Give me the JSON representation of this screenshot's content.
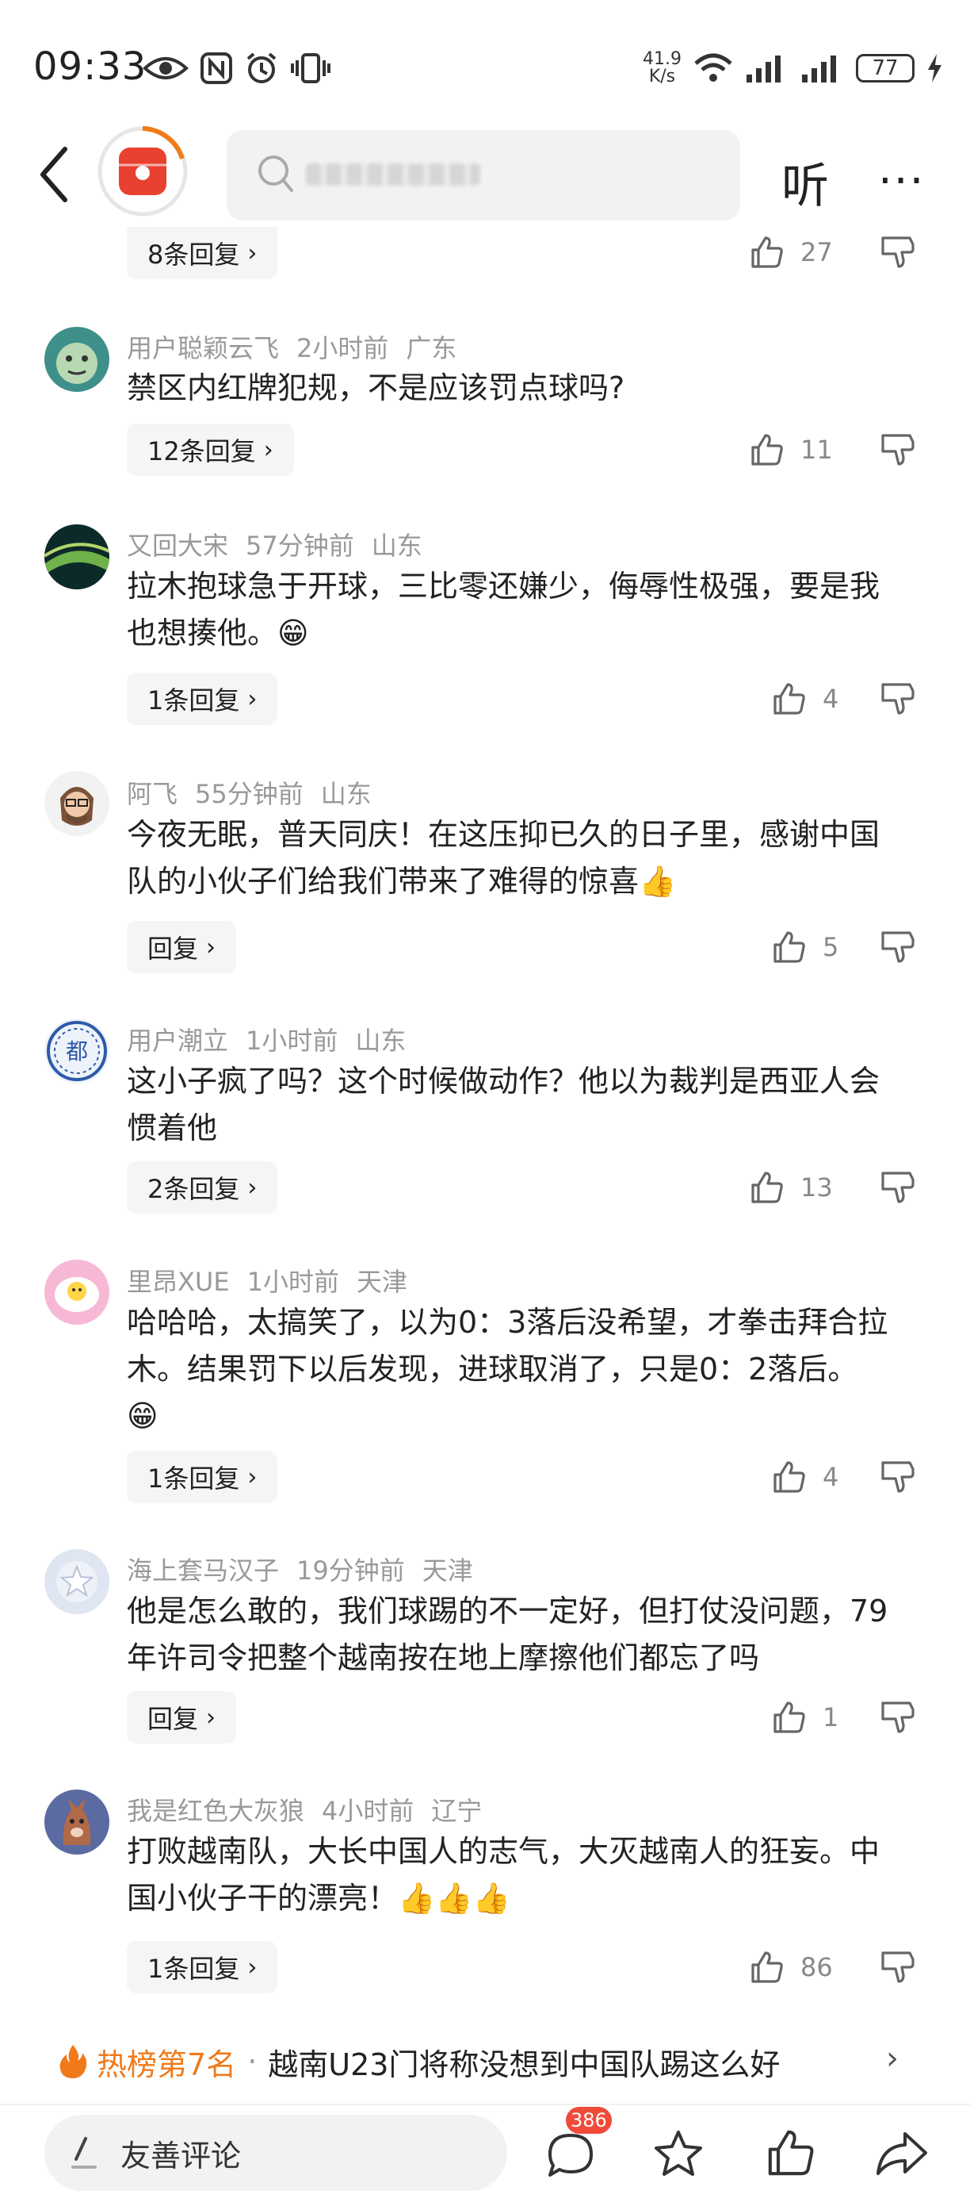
{
  "status_bar": {
    "time": "09:33",
    "net_speed_value": "41.9",
    "net_speed_unit": "K/s",
    "battery": "77"
  },
  "header": {
    "search_placeholder": "",
    "listen_label": "听",
    "more_label": "···"
  },
  "top_partial": {
    "reply_label": "8条回复",
    "likes": "27"
  },
  "comments": [
    {
      "user": "用户聪颖云飞",
      "time": "2小时前",
      "location": "广东",
      "lines": [
        "禁区内红牌犯规，不是应该罚点球吗?"
      ],
      "reply_label": "12条回复",
      "likes": "11"
    },
    {
      "user": "又回大宋",
      "time": "57分钟前",
      "location": "山东",
      "lines": [
        "拉木抱球急于开球，三比零还嫌少，侮辱性极强，要是我",
        "也想揍他。😁"
      ],
      "reply_label": "1条回复",
      "likes": "4"
    },
    {
      "user": "阿飞",
      "time": "55分钟前",
      "location": "山东",
      "lines": [
        "今夜无眠，普天同庆！在这压抑已久的日子里，感谢中国",
        "队的小伙子们给我们带来了难得的惊喜👍"
      ],
      "reply_label": "回复",
      "likes": "5"
    },
    {
      "user": "用户潮立",
      "time": "1小时前",
      "location": "山东",
      "lines": [
        "这小子疯了吗？这个时候做动作？他以为裁判是西亚人会",
        "惯着他"
      ],
      "reply_label": "2条回复",
      "likes": "13"
    },
    {
      "user": "里昂XUE",
      "time": "1小时前",
      "location": "天津",
      "lines": [
        "哈哈哈，太搞笑了，以为0：3落后没希望，才拳击拜合拉",
        "木。结果罚下以后发现，进球取消了，只是0：2落后。",
        "😁"
      ],
      "reply_label": "1条回复",
      "likes": "4"
    },
    {
      "user": "海上套马汉子",
      "time": "19分钟前",
      "location": "天津",
      "lines": [
        "他是怎么敢的，我们球踢的不一定好，但打仗没问题，79",
        "年许司令把整个越南按在地上摩擦他们都忘了吗"
      ],
      "reply_label": "回复",
      "likes": "1"
    },
    {
      "user": "我是红色大灰狼",
      "time": "4小时前",
      "location": "辽宁",
      "lines": [
        "打败越南队，大长中国人的志气，大灭越南人的狂妄。中",
        "国小伙子干的漂亮！👍👍👍"
      ],
      "reply_label": "1条回复",
      "likes": "86"
    }
  ],
  "hot_rank": {
    "rank_label": "热榜第7名",
    "separator": "·",
    "title": "越南U23门将称没想到中国队踢这么好"
  },
  "bottom_bar": {
    "comment_placeholder": "友善评论",
    "comment_count": "386"
  },
  "colors": {
    "accent": "#f07a1a",
    "badge": "#f04a3a",
    "logo_red": "#e8412f"
  }
}
